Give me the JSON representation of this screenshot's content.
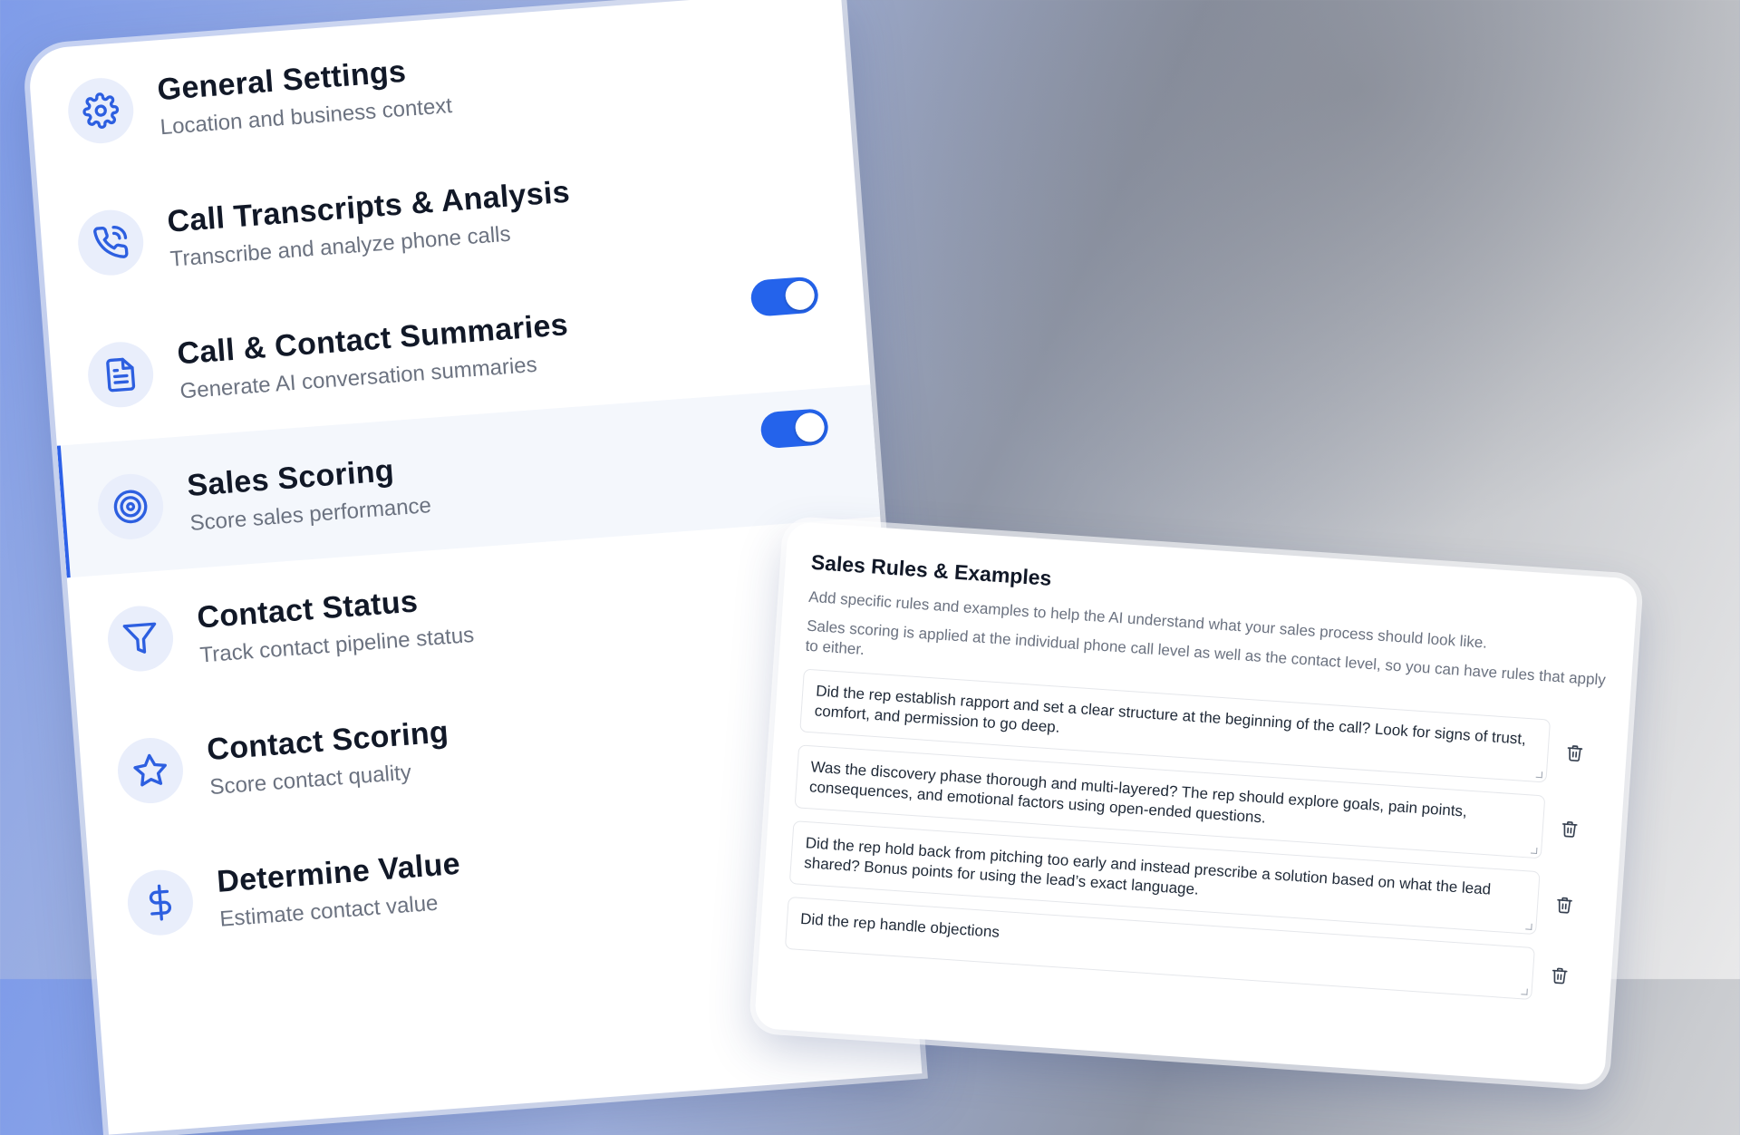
{
  "settings": {
    "items": [
      {
        "title": "General Settings",
        "subtitle": "Location and business context",
        "icon": "gear-icon"
      },
      {
        "title": "Call Transcripts & Analysis",
        "subtitle": "Transcribe and analyze phone calls",
        "icon": "phone-icon"
      },
      {
        "title": "Call & Contact Summaries",
        "subtitle": "Generate AI conversation summaries",
        "icon": "document-icon",
        "toggle": "on"
      },
      {
        "title": "Sales Scoring",
        "subtitle": "Score sales performance",
        "icon": "target-icon",
        "toggle": "on",
        "selected": true
      },
      {
        "title": "Contact Status",
        "subtitle": "Track contact pipeline status",
        "icon": "filter-icon"
      },
      {
        "title": "Contact Scoring",
        "subtitle": "Score contact quality",
        "icon": "star-icon"
      },
      {
        "title": "Determine Value",
        "subtitle": "Estimate contact value",
        "icon": "dollar-icon"
      }
    ]
  },
  "rules": {
    "title": "Sales Rules & Examples",
    "description": "Add specific rules and examples to help the AI understand what your sales process should look like.",
    "note": "Sales scoring is applied at the individual phone call level as well as the contact level, so you can have rules that apply to either.",
    "items": [
      "Did the rep establish rapport and set a clear structure at the beginning of the call? Look for signs of trust, comfort, and permission to go deep.",
      "Was the discovery phase thorough and multi-layered? The rep should explore goals, pain points, consequences, and emotional factors using open-ended questions.",
      "Did the rep hold back from pitching too early and instead prescribe a solution based on what the lead shared? Bonus points for using the lead’s exact language.",
      "Did the rep handle objections"
    ]
  },
  "colors": {
    "accent": "#2463eb",
    "icon_bg": "#e9eefb",
    "title_text": "#111827",
    "muted_text": "#6b7280"
  }
}
